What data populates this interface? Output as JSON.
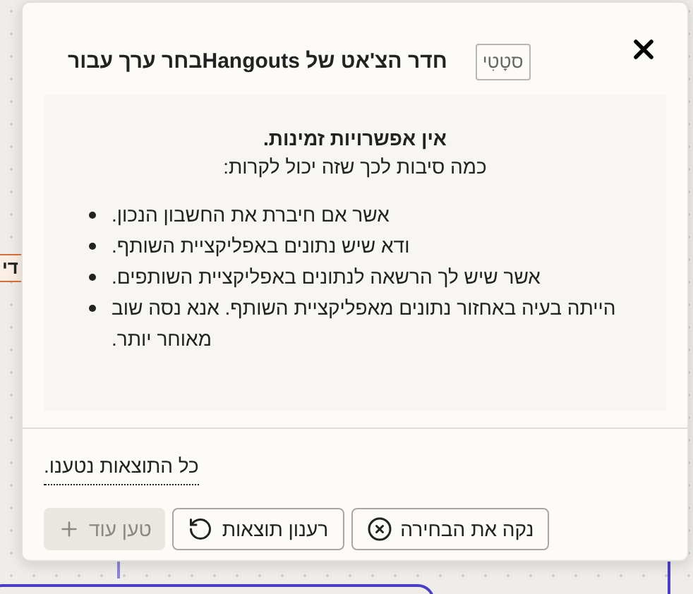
{
  "background": {
    "card_text": "די"
  },
  "dialog": {
    "title": "בחר ערך עבורHangouts חדר הצ'אט של",
    "badge": "סטָטִי",
    "empty_state": {
      "heading": "אין אפשרויות זמינות.",
      "subheading": "כמה סיבות לכך שזה יכול לקרות:",
      "reasons": [
        "אשר אם חיברת את החשבון הנכון.",
        "ודא שיש נתונים באפליקציית השותף.",
        "אשר שיש לך הרשאה לנתונים באפליקציית השותפים.",
        "הייתה בעיה באחזור נתונים מאפליקציית השותף. אנא נסה שוב מאוחר יותר."
      ]
    },
    "status": "כל התוצאות נטענו.",
    "buttons": [
      {
        "kind": "clear",
        "label": "נקה את הבחירה",
        "disabled": false
      },
      {
        "kind": "refresh",
        "label": "רענון תוצאות",
        "disabled": false
      },
      {
        "kind": "load_more",
        "label": "טען עוד",
        "disabled": true
      }
    ]
  }
}
